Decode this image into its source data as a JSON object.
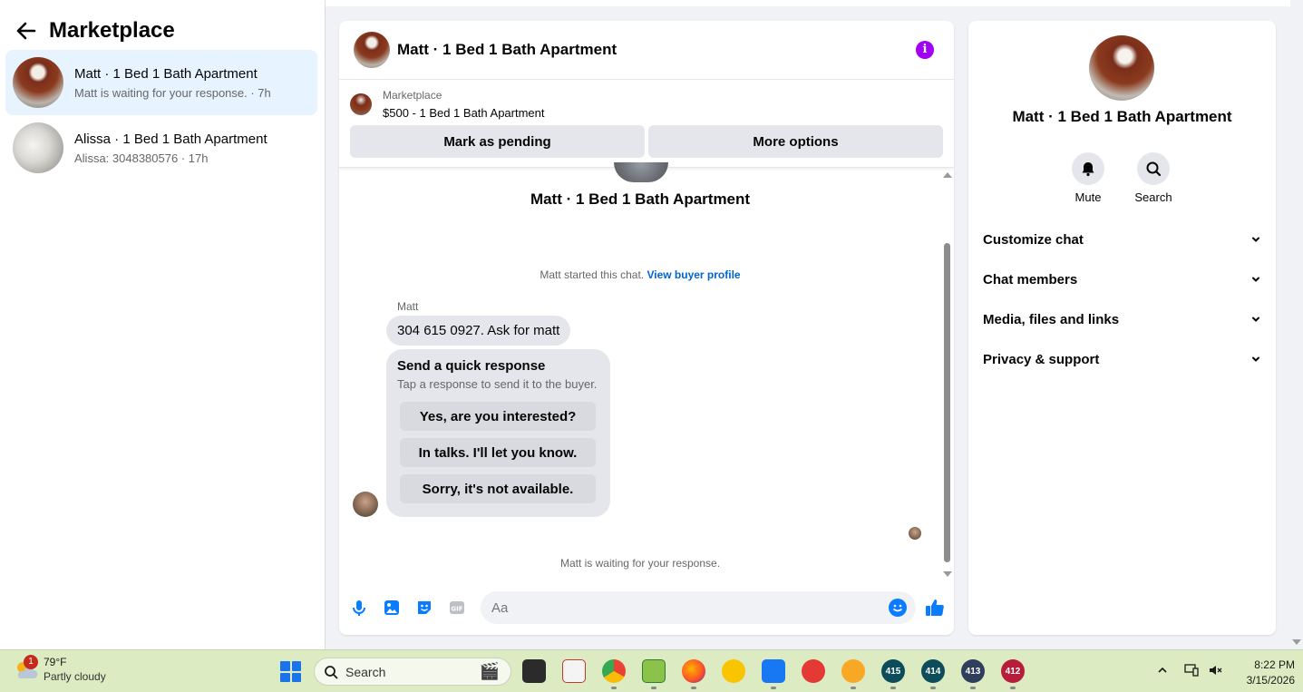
{
  "sidebar": {
    "title": "Marketplace",
    "conversations": [
      {
        "name": "Matt · 1 Bed 1 Bath Apartment",
        "subtitle": "Matt is waiting for your response. · 7h",
        "active": true
      },
      {
        "name": "Alissa · 1 Bed 1 Bath Apartment",
        "subtitle": "Alissa: 3048380576 · 17h",
        "active": false
      }
    ]
  },
  "chat": {
    "header_title": "Matt · 1 Bed 1 Bath Apartment",
    "listing": {
      "source": "Marketplace",
      "title": "$500 - 1 Bed 1 Bath Apartment",
      "mark_pending_label": "Mark as pending",
      "more_options_label": "More options"
    },
    "center_title": "Matt · 1 Bed 1 Bath Apartment",
    "started_text": "Matt started this chat.",
    "view_buyer_profile": "View buyer profile",
    "sender_name": "Matt",
    "message_text": "304 615 0927. Ask for matt",
    "quick_response": {
      "title": "Send a quick response",
      "subtitle": "Tap a response to send it to the buyer.",
      "options": [
        "Yes, are you interested?",
        "In talks. I'll let you know.",
        "Sorry, it's not available."
      ]
    },
    "waiting_text": "Matt is waiting for your response.",
    "composer_placeholder": "Aa"
  },
  "details": {
    "name": "Matt · 1 Bed 1 Bath Apartment",
    "mute_label": "Mute",
    "search_label": "Search",
    "menu": [
      "Customize chat",
      "Chat members",
      "Media, files and links",
      "Privacy & support"
    ]
  },
  "taskbar": {
    "weather_temp": "79°F",
    "weather_desc": "Partly cloudy",
    "weather_badge": "1",
    "search_label": "Search",
    "app_badges": [
      "415",
      "414",
      "413",
      "412"
    ],
    "time": "8:22 PM",
    "date": "3/15/2026"
  },
  "colors": {
    "accent_blue": "#0a7cff",
    "active_conv_bg": "#e7f3ff",
    "info_purple": "#a100f2",
    "taskbar_bg": "#dcebc1"
  }
}
